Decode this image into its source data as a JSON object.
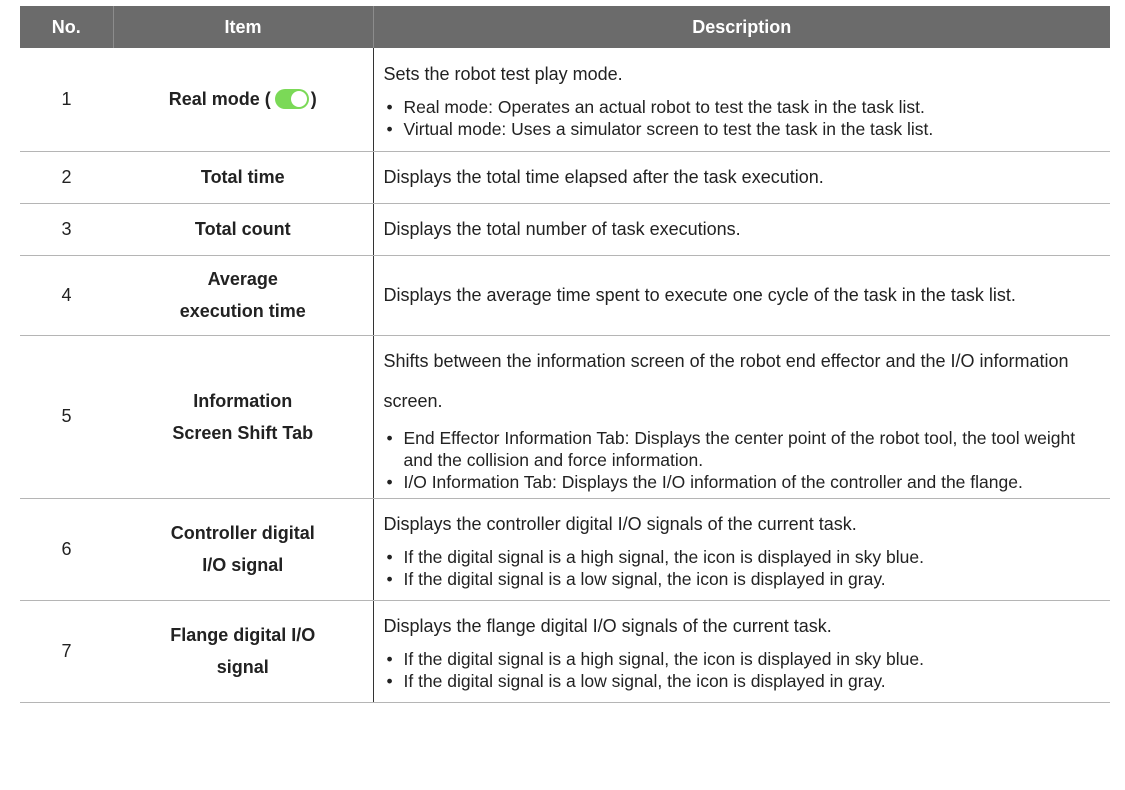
{
  "headers": {
    "no": "No.",
    "item": "Item",
    "description": "Description"
  },
  "toggle_color": "#7bd957",
  "rows": [
    {
      "no": "1",
      "item_prefix": "Real mode (",
      "item_suffix": ")",
      "toggle_icon": "toggle-on-icon",
      "main": "Sets the robot test play mode.",
      "bullets": [
        "Real mode: Operates an actual robot to test the task in the task list.",
        "Virtual mode: Uses a simulator screen to test the task in the task list."
      ]
    },
    {
      "no": "2",
      "item": "Total time",
      "main": "Displays the total time elapsed after the task execution."
    },
    {
      "no": "3",
      "item": "Total count",
      "main": "Displays the total number of task executions."
    },
    {
      "no": "4",
      "item_line1": "Average",
      "item_line2": "execution time",
      "main": "Displays the average time spent to execute one cycle of the task in the task list."
    },
    {
      "no": "5",
      "item_line1": "Information",
      "item_line2": "Screen Shift Tab",
      "main": "Shifts between the information screen of the robot end effector and the I/O information screen.",
      "bullets": [
        "End Effector Information Tab: Displays the center point of the robot tool, the tool weight and the collision and force information.",
        "I/O Information Tab: Displays the I/O information of the controller and the flange."
      ]
    },
    {
      "no": "6",
      "item_line1": "Controller digital",
      "item_line2": "I/O signal",
      "main": "Displays the controller digital I/O signals of the current task.",
      "bullets": [
        "If the digital signal is a high signal, the icon is displayed in sky blue.",
        "If the digital signal is a low signal, the icon is displayed in gray."
      ]
    },
    {
      "no": "7",
      "item_line1": "Flange digital I/O",
      "item_line2": "signal",
      "main": "Displays the flange digital I/O signals of the current task.",
      "bullets": [
        "If the digital signal is a high signal, the icon is displayed in sky blue.",
        "If the digital signal is a low signal, the icon is displayed in gray."
      ]
    }
  ]
}
